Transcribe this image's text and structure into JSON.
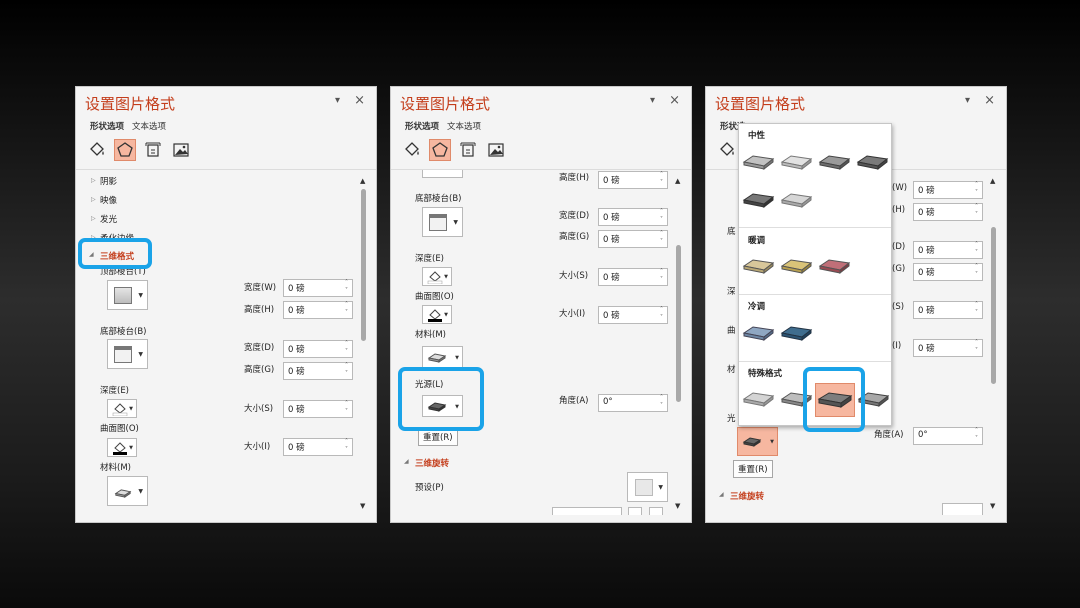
{
  "panel": {
    "title": "设置图片格式",
    "close": "×",
    "dropdown": "▾",
    "tab_shape": "形状选项",
    "tab_text": "文本选项"
  },
  "icons": [
    "fill-line-icon",
    "effects-icon",
    "size-properties-icon",
    "picture-icon"
  ],
  "p1": {
    "items": [
      "阴影",
      "映像",
      "发光",
      "柔化边缘"
    ],
    "format3d": "三维格式",
    "top_bevel": "顶部棱台(T)",
    "bottom_bevel": "底部棱台(B)",
    "width_w": "宽度(W)",
    "height_h": "高度(H)",
    "width_d": "宽度(D)",
    "height_g": "高度(G)",
    "depth": "深度(E)",
    "contour": "曲面图(O)",
    "size_s": "大小(S)",
    "size_i": "大小(I)",
    "material": "材料(M)",
    "value": "0 磅"
  },
  "p2": {
    "height_h": "高度(H)",
    "bottom_bevel": "底部棱台(B)",
    "width_d": "宽度(D)",
    "height_g": "高度(G)",
    "depth": "深度(E)",
    "size_s": "大小(S)",
    "contour": "曲面图(O)",
    "size_i": "大小(I)",
    "material": "材料(M)",
    "lighting": "光源(L)",
    "angle": "角度(A)",
    "angle_value": "0°",
    "reset": "重置(R)",
    "rotation3d": "三维旋转",
    "preset": "预设(P)",
    "value": "0 磅"
  },
  "p3": {
    "tab_shape_partial": "形状选",
    "w_suffix": "(W)",
    "h_suffix": "(H)",
    "d_suffix": "(D)",
    "g_suffix": "(G)",
    "s_suffix": "(S)",
    "i_suffix": "(I)",
    "left_partials": [
      "底",
      "深",
      "曲",
      "材",
      "光"
    ],
    "angle": "角度(A)",
    "angle_value": "0°",
    "reset": "重置(R)",
    "rotation3d": "三维旋转",
    "value": "0 磅"
  },
  "gallery": {
    "sections": [
      "中性",
      "暖调",
      "冷调",
      "特殊格式"
    ]
  },
  "colors": {
    "accent": "#c43e1c",
    "highlight": "#1aa3e8",
    "selected": "#f6b7a0"
  }
}
